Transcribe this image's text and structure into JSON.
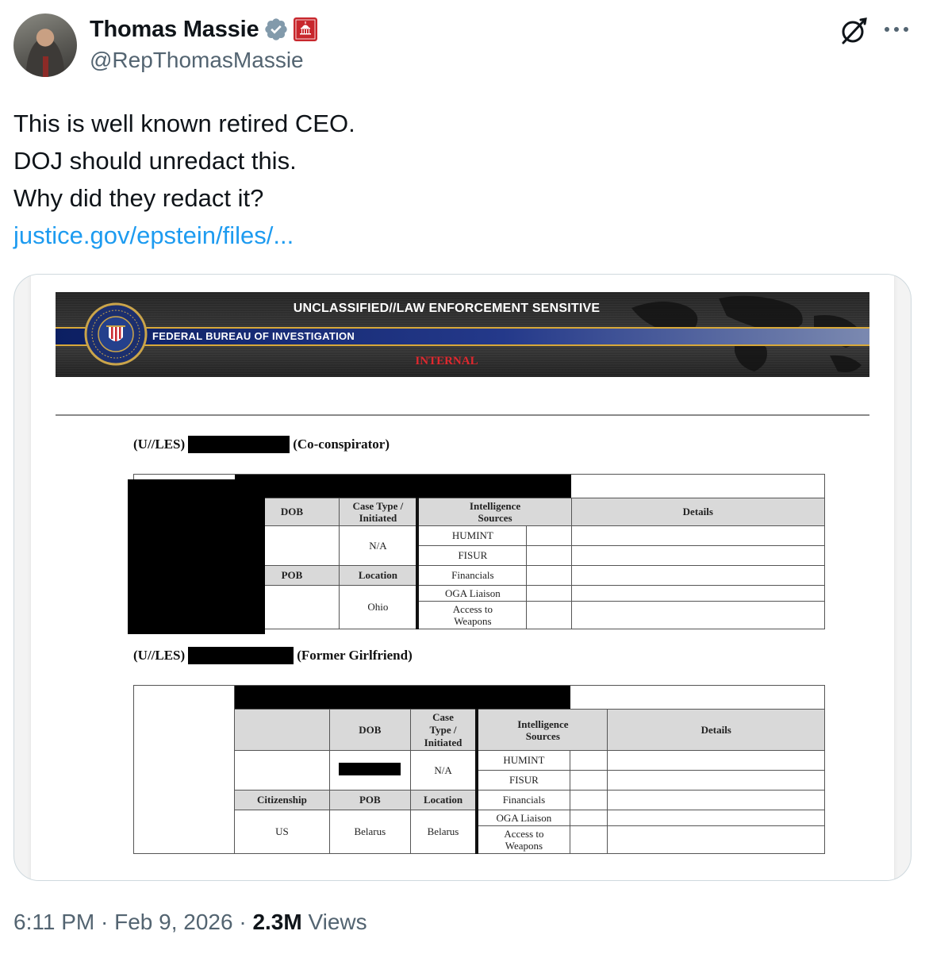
{
  "author": {
    "name": "Thomas Massie",
    "handle": "@RepThomasMassie"
  },
  "icons": {
    "verified": "verified-badge-icon",
    "affiliation": "us-capitol-affiliation-icon",
    "grok": "grok-icon",
    "more": "more-icon"
  },
  "tweet": {
    "lines": [
      "This is well known retired CEO.",
      "DOJ should unredact this.",
      "Why did they redact it?"
    ],
    "link": "justice.gov/epstein/files/..."
  },
  "document": {
    "banner_title": "UNCLASSIFIED//LAW ENFORCEMENT SENSITIVE",
    "agency": "FEDERAL BUREAU OF INVESTIGATION",
    "marking": "INTERNAL",
    "subject1": {
      "prefix": "(U//LES)",
      "role": "(Co-conspirator)"
    },
    "subject2": {
      "prefix": "(U//LES)",
      "role": "(Former Girlfriend)"
    },
    "headers": {
      "dob": "DOB",
      "case_type_1": "Case Type /",
      "case_type_2": "Initiated",
      "case_2_l1": "Case",
      "case_2_l2": "Type /",
      "case_2_l3": "Initiated",
      "intel_1": "Intelligence",
      "intel_2": "Sources",
      "details": "Details",
      "citizenship_partial": "tizenship",
      "citizenship": "Citizenship",
      "pob": "POB",
      "location": "Location"
    },
    "sources": {
      "humint": "HUMINT",
      "fisur": "FISUR",
      "financials": "Financials",
      "oga": "OGA Liaison",
      "weapons_1": "Access to",
      "weapons_2": "Weapons"
    },
    "table1": {
      "case_type": "N/A",
      "location": "Ohio"
    },
    "table2": {
      "case_type": "N/A",
      "citizenship": "US",
      "pob": "Belarus",
      "location": "Belarus"
    }
  },
  "footer": {
    "time": "6:11 PM",
    "sep1": "·",
    "date": "Feb 9, 2026",
    "sep2": "·",
    "views_count": "2.3M",
    "views_label": "Views"
  },
  "colors": {
    "text": "#0f1419",
    "secondary": "#536471",
    "link": "#1d9bf0",
    "verified": "#829aab",
    "gov_badge": "#c8272d"
  }
}
